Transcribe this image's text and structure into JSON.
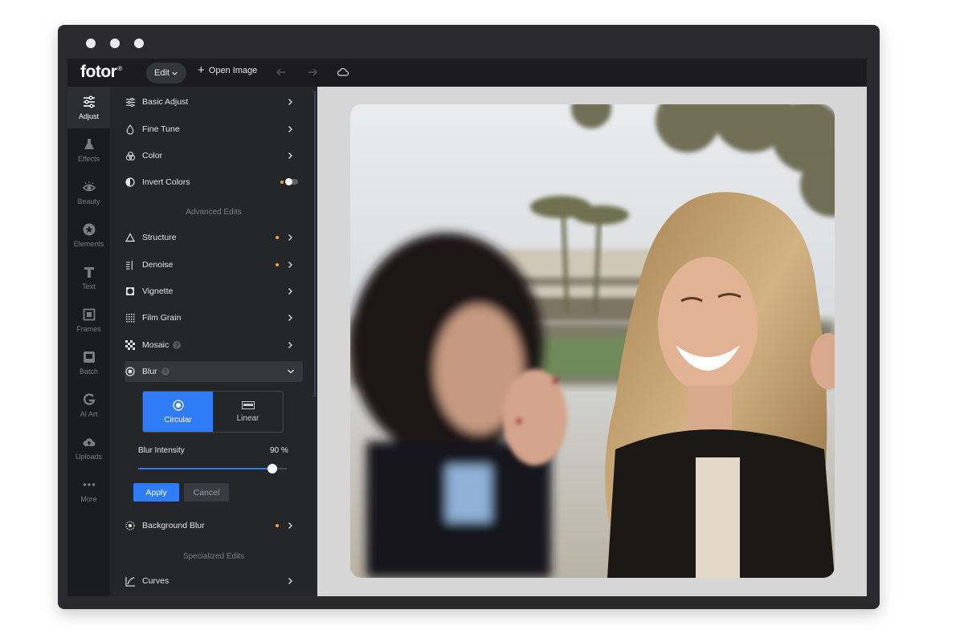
{
  "app": {
    "logo": "fotor",
    "logo_mark": "®"
  },
  "toolbar": {
    "edit_label": "Edit",
    "open_image_label": "Open Image"
  },
  "rail": {
    "items": [
      {
        "label": "Adjust",
        "icon": "sliders-icon",
        "active": true
      },
      {
        "label": "Effects",
        "icon": "flask-icon"
      },
      {
        "label": "Beauty",
        "icon": "eye-icon"
      },
      {
        "label": "Elements",
        "icon": "star-circle-icon"
      },
      {
        "label": "Text",
        "icon": "text-t-icon"
      },
      {
        "label": "Frames",
        "icon": "frame-icon"
      },
      {
        "label": "Batch",
        "icon": "batch-image-icon"
      },
      {
        "label": "AI Art",
        "icon": "ai-art-icon"
      },
      {
        "label": "Uploads",
        "icon": "cloud-upload-icon"
      },
      {
        "label": "More",
        "icon": "dots-icon"
      }
    ]
  },
  "panel": {
    "basic_adjust": "Basic Adjust",
    "fine_tune": "Fine Tune",
    "color": "Color",
    "invert_colors": "Invert Colors",
    "advanced_edits_title": "Advanced Edits",
    "structure": "Structure",
    "denoise": "Denoise",
    "vignette": "Vignette",
    "film_grain": "Film Grain",
    "mosaic": "Mosaic",
    "blur": "Blur",
    "help_mark": "?",
    "blur_modes": {
      "circular": "Circular",
      "linear": "Linear",
      "selected": "Circular"
    },
    "blur_intensity_label": "Blur Intensity",
    "blur_intensity_value": "90 %",
    "blur_intensity": 0.9,
    "apply_label": "Apply",
    "cancel_label": "Cancel",
    "background_blur": "Background Blur",
    "specialized_edits_title": "Specialized Edits",
    "curves": "Curves"
  },
  "colors": {
    "accent": "#2f7cf6",
    "new_dot": "#f2a33a",
    "panel_bg": "#25262a",
    "canvas_bg": "#d6d6d6"
  }
}
